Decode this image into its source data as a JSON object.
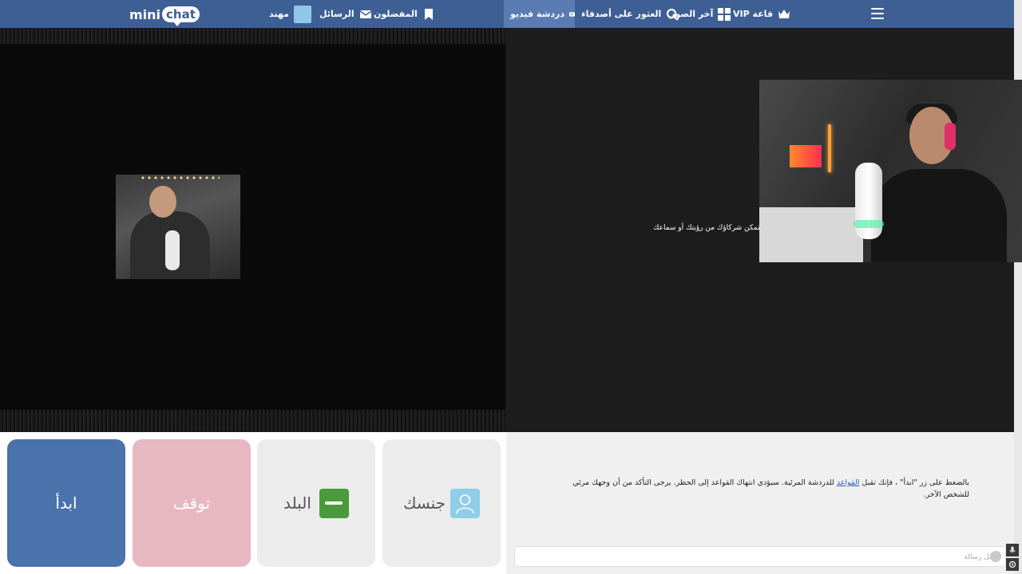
{
  "nav": {
    "logo_mini": "mini",
    "logo_chat": "chat",
    "user": "مهند",
    "messages": "الرسائل",
    "favorites": "المفضلون",
    "video_chat": "دردشة فيديو",
    "find_friends": "العثور على أصدقاء",
    "latest_photos": "آخر الصور",
    "vip_hall": "قاعة VIP"
  },
  "video": {
    "partner_notice": "ن يتمكن شركاؤك من رؤيتك أو سماعك"
  },
  "controls": {
    "start": "ابدأ",
    "stop": "توقف",
    "country": "البلد",
    "gender": "جنسك"
  },
  "chat": {
    "rules_before": "بالضغط على زر \"ابدأ\" ، فإنك تقبل ",
    "rules_link": "القواعد",
    "rules_after": " للدردشة المرئية. سيؤدي انتهاك القواعد إلى الحظر. يرجى التأكد من أن وجهك مرئي للشخص الآخر.",
    "input_placeholder": "أدخل رسالة"
  },
  "colors": {
    "topbar": "#3e5f94",
    "nav_active": "#5a7cb3",
    "start_button": "#4a72ab",
    "stop_button": "#e7b8c2",
    "flag_green": "#4a9a3c"
  },
  "icons": [
    "menu-icon",
    "crown-icon",
    "grid-icon",
    "search-icon",
    "video-icon",
    "bookmark-icon",
    "envelope-icon",
    "user-icon",
    "saudi-flag-icon",
    "gender-icon",
    "emoji-icon",
    "microphone-icon",
    "settings-icon"
  ]
}
